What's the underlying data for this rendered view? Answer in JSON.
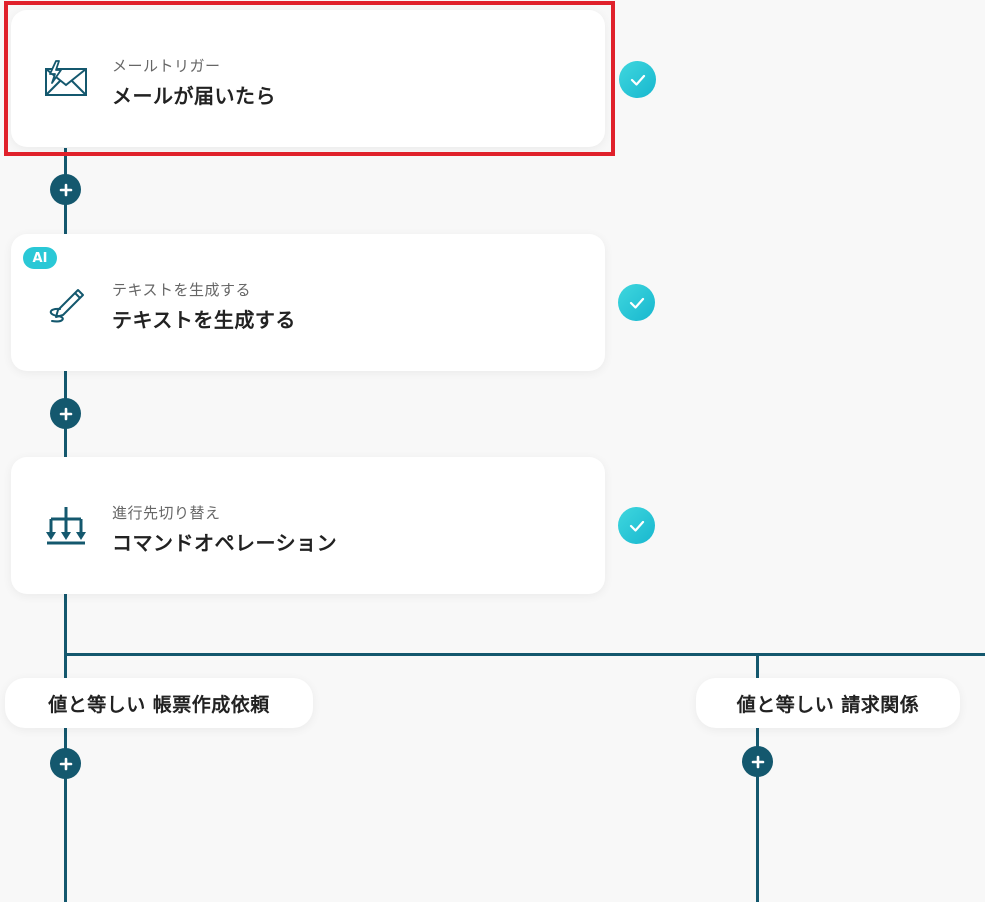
{
  "steps": [
    {
      "subtitle": "メールトリガー",
      "title": "メールが届いたら",
      "icon": "mail-trigger-icon",
      "status": "check-icon"
    },
    {
      "badge": "AI",
      "subtitle": "テキストを生成する",
      "title": "テキストを生成する",
      "icon": "pen-icon",
      "status": "check-icon"
    },
    {
      "subtitle": "進行先切り替え",
      "title": "コマンドオペレーション",
      "icon": "branch-icon",
      "status": "check-icon"
    }
  ],
  "branches": [
    {
      "label": "値と等しい 帳票作成依頼"
    },
    {
      "label": "値と等しい 請求関係"
    }
  ],
  "colors": {
    "line": "#14586e",
    "accent": "#2ac8d6",
    "highlight": "#e0212b",
    "background": "#f8f8f8"
  }
}
